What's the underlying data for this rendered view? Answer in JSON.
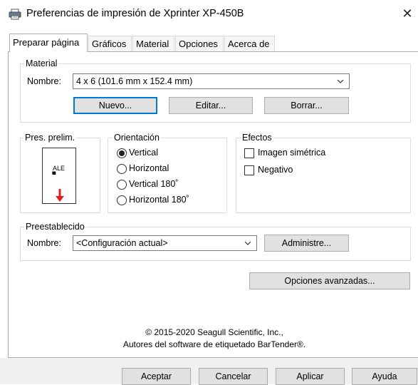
{
  "window": {
    "title": "Preferencias de impresión de Xprinter XP-450B",
    "close_glyph": "✕",
    "icon": "printer-icon"
  },
  "tabs": [
    {
      "label": "Preparar página",
      "active": true
    },
    {
      "label": "Gráficos",
      "active": false
    },
    {
      "label": "Material",
      "active": false
    },
    {
      "label": "Opciones",
      "active": false
    },
    {
      "label": "Acerca de",
      "active": false
    }
  ],
  "material": {
    "group_label": "Material",
    "name_label": "Nombre:",
    "selected": "4 x 6 (101.6 mm x 152.4 mm)",
    "buttons": {
      "new": "Nuevo...",
      "edit": "Editar...",
      "delete": "Borrar..."
    }
  },
  "preview": {
    "group_label": "Pres. prelim.",
    "sample_text": "ALE",
    "barcode_glyph": "IIIIIII",
    "arrow_color": "#e02020"
  },
  "orientation": {
    "group_label": "Orientación",
    "options": [
      {
        "label": "Vertical",
        "checked": true
      },
      {
        "label": "Horizontal",
        "checked": false
      },
      {
        "label": "Vertical 180˚",
        "checked": false
      },
      {
        "label": "Horizontal 180˚",
        "checked": false
      }
    ]
  },
  "effects": {
    "group_label": "Efectos",
    "options": [
      {
        "label": "Imagen simétrica",
        "checked": false
      },
      {
        "label": "Negativo",
        "checked": false
      }
    ]
  },
  "preset": {
    "group_label": "Preestablecido",
    "name_label": "Nombre:",
    "selected": "<Configuración actual>",
    "manage_button": "Administre..."
  },
  "advanced_button": "Opciones avanzadas...",
  "footer": {
    "copyright": "© 2015-2020 Seagull Scientific, Inc.,",
    "credits": "Autores del software de etiquetado BarTender®."
  },
  "dialog_buttons": {
    "ok": "Aceptar",
    "cancel": "Cancelar",
    "apply": "Aplicar",
    "help": "Ayuda"
  },
  "colors": {
    "focus_border": "#0078d7",
    "button_face": "#e1e1e1",
    "group_border": "#dcdcdc"
  }
}
